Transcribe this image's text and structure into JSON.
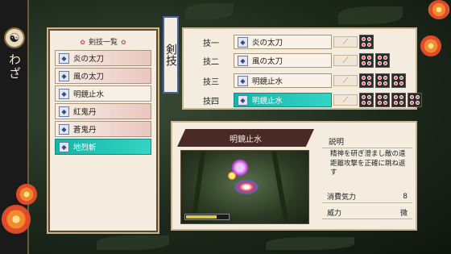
{
  "sidebar": {
    "title": "わざ",
    "emblem_icon": "yin-yang-icon"
  },
  "list": {
    "title": "剣技一覧",
    "items": [
      {
        "label": "炎の太刀",
        "state": "equipped"
      },
      {
        "label": "風の太刀",
        "state": "equipped"
      },
      {
        "label": "明鏡止水",
        "state": "plain"
      },
      {
        "label": "紅鬼丹",
        "state": "equipped"
      },
      {
        "label": "蒼鬼丹",
        "state": "equipped"
      },
      {
        "label": "地烈斬",
        "state": "selected"
      }
    ]
  },
  "category": {
    "label": "剣技"
  },
  "slots": [
    {
      "label": "技一",
      "skill": "炎の太刀",
      "dots": 1
    },
    {
      "label": "技二",
      "skill": "風の太刀",
      "dots": 2
    },
    {
      "label": "技三",
      "skill": "明鏡止水",
      "dots": 3
    },
    {
      "label": "技四",
      "skill": "明鏡止水",
      "dots": 4,
      "selected": true
    }
  ],
  "detail": {
    "name": "明鏡止水",
    "description_heading": "説明",
    "description": "精神を研ぎ澄まし敵の遠距離攻撃を正確に跳ね返す",
    "stats": [
      {
        "label": "消費気力",
        "value": "8"
      },
      {
        "label": "威力",
        "value": "微"
      }
    ]
  },
  "colors": {
    "selected": "#12b7a8",
    "banner": "#4a2a26",
    "panel": "#f3ecdf",
    "dot": "#e35050"
  }
}
